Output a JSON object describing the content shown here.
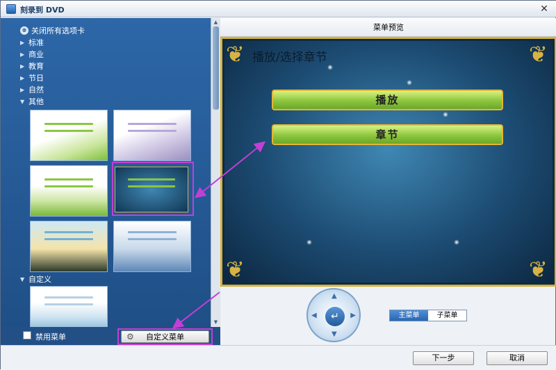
{
  "window": {
    "title": "刻录到 DVD",
    "close_glyph": "✕"
  },
  "left": {
    "close_all_tabs": "关闭所有选项卡",
    "categories": [
      {
        "label": "标准",
        "expanded": false
      },
      {
        "label": "商业",
        "expanded": false
      },
      {
        "label": "教育",
        "expanded": false
      },
      {
        "label": "节日",
        "expanded": false
      },
      {
        "label": "自然",
        "expanded": false
      },
      {
        "label": "其他",
        "expanded": true
      }
    ],
    "custom_category": {
      "label": "自定义",
      "expanded": true
    },
    "disable_menu_label": "禁用菜单",
    "custom_menu_button": "自定义菜单"
  },
  "preview": {
    "header": "菜单预览",
    "top_text": "播放/选择章节",
    "menu_buttons": [
      "播放",
      "章节"
    ]
  },
  "menu_tabs": [
    {
      "label": "主菜单",
      "active": true
    },
    {
      "label": "子菜单",
      "active": false
    }
  ],
  "footer": {
    "next_label": "下一步",
    "cancel_label": "取消"
  },
  "colors": {
    "annotation": "#c23fd6",
    "panel_blue": "#2d67a8",
    "button_green": "#8cc63f"
  }
}
